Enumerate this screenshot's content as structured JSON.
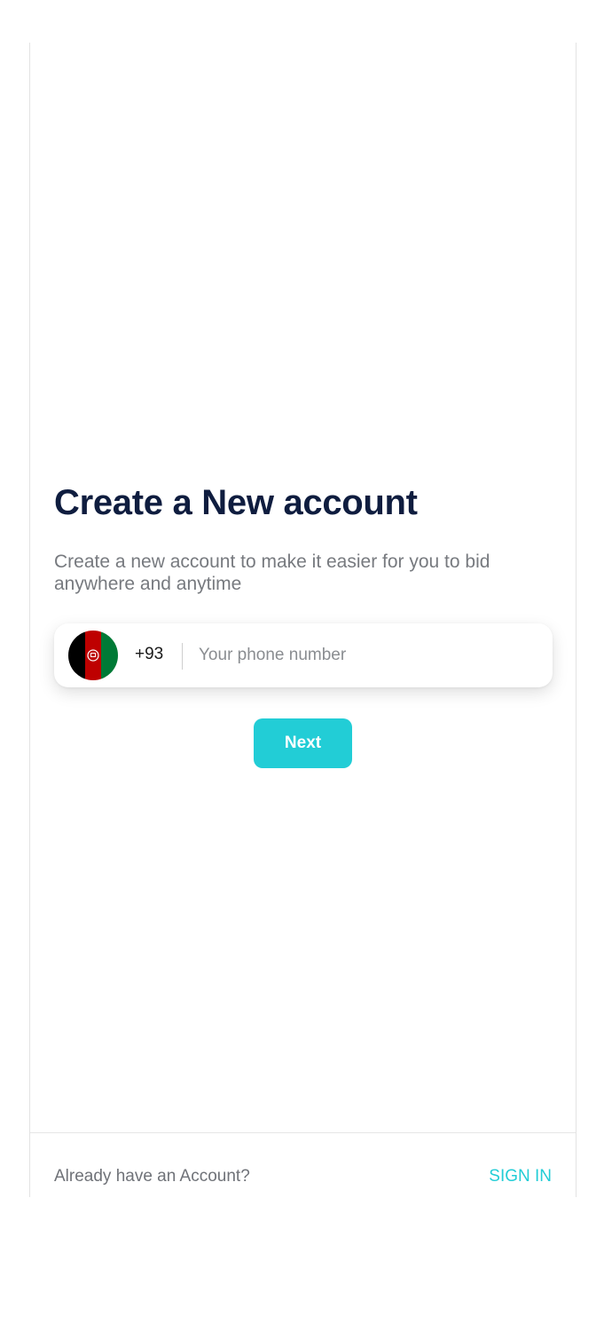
{
  "signup": {
    "title": "Create a New account",
    "subtitle": "Create a new account to make it easier for you to bid anywhere and anytime"
  },
  "phone": {
    "country_flag_icon": "afghanistan-flag-icon",
    "dial_code": "+93",
    "value": "",
    "placeholder": "Your phone number"
  },
  "actions": {
    "next_label": "Next"
  },
  "footer": {
    "prompt": "Already have an Account?",
    "signin_label": "SIGN IN"
  },
  "colors": {
    "title": "#0f1d3f",
    "accent": "#22cdd6",
    "flag_black": "#000000",
    "flag_red": "#be0000",
    "flag_green": "#007a36"
  }
}
